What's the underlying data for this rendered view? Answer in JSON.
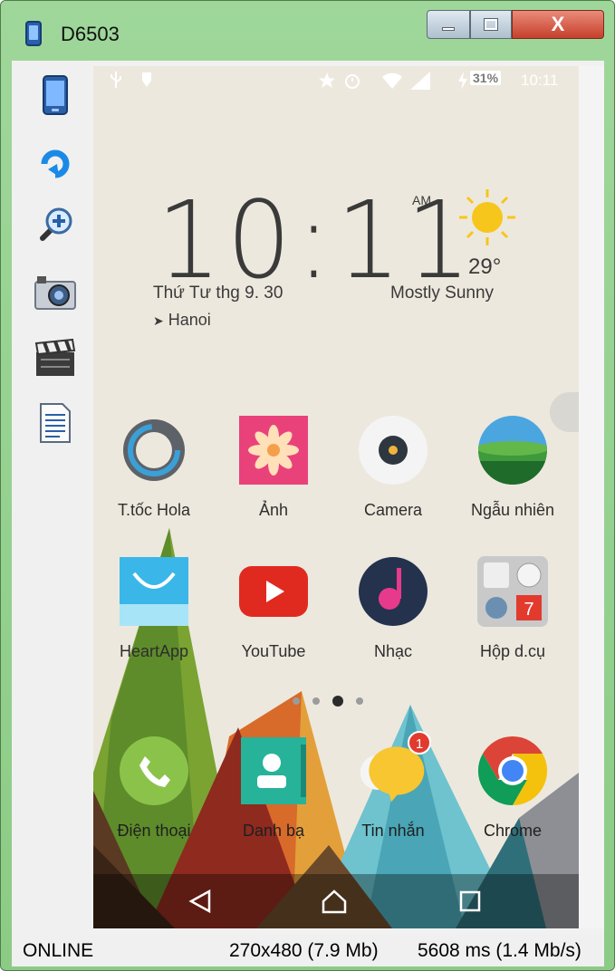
{
  "window": {
    "title": "D6503",
    "close_glyph": "X"
  },
  "toolbar": {
    "tools": [
      {
        "name": "phone-icon"
      },
      {
        "name": "rotate-icon"
      },
      {
        "name": "zoom-in-icon"
      },
      {
        "name": "camera-icon"
      },
      {
        "name": "clapperboard-icon"
      },
      {
        "name": "document-icon"
      }
    ]
  },
  "phone": {
    "statusbar": {
      "battery": "31%",
      "time": "10:11"
    },
    "clock": {
      "time": "10:11",
      "ampm": "AM",
      "date": "Thứ Tư thg 9. 30",
      "location": "Hanoi"
    },
    "weather": {
      "temp": "29°",
      "desc": "Mostly Sunny"
    },
    "apps_row1": [
      {
        "label": "T.tốc Hola"
      },
      {
        "label": "Ảnh"
      },
      {
        "label": "Camera"
      },
      {
        "label": "Ngẫu nhiên"
      }
    ],
    "apps_row2": [
      {
        "label": "HeartApp"
      },
      {
        "label": "YouTube"
      },
      {
        "label": "Nhạc"
      },
      {
        "label": "Hộp d.cụ"
      }
    ],
    "dock": [
      {
        "label": "Điện thoại"
      },
      {
        "label": "Danh bạ"
      },
      {
        "label": "Tin nhắn",
        "badge": "1"
      },
      {
        "label": "Chrome"
      }
    ],
    "toolbox_tile": "7",
    "page_indicator": {
      "count": 4,
      "active": 3
    }
  },
  "status": {
    "connection": "ONLINE",
    "resolution": "270x480 (7.9 Mb)",
    "latency": "5608 ms (1.4 Mb/s)"
  },
  "colors": {
    "frame": "#9fd79a",
    "wallpaper": "#ede8dd",
    "accent_red": "#e23b2e"
  }
}
